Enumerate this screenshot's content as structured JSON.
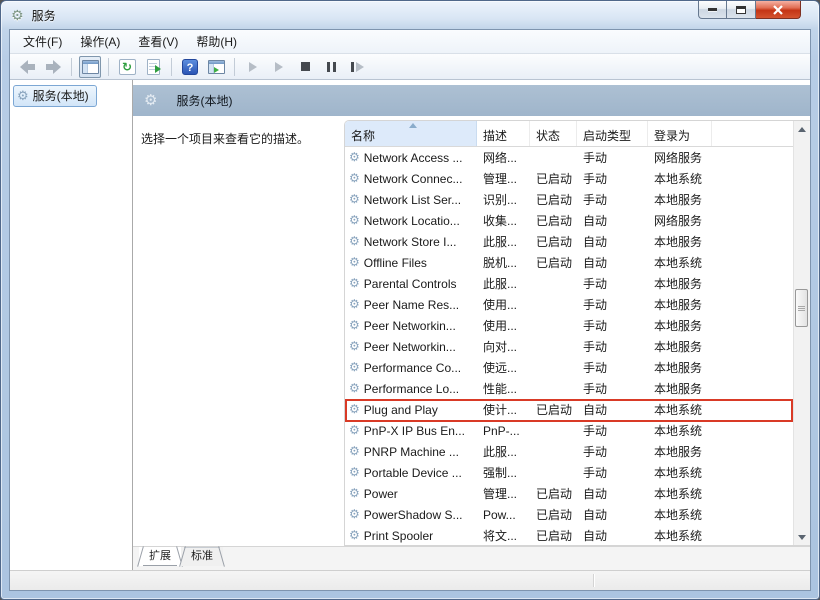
{
  "window": {
    "title": "服务",
    "controls": {
      "minimize": "minimize",
      "maximize": "maximize",
      "close": "close"
    }
  },
  "menu": {
    "items": [
      "文件(F)",
      "操作(A)",
      "查看(V)",
      "帮助(H)"
    ]
  },
  "toolbar": {
    "icons": [
      "back",
      "forward",
      "show-console-tree",
      "refresh",
      "export-list",
      "help",
      "show-action-pane",
      "start-service",
      "resume-service",
      "stop-service",
      "pause-service",
      "restart-service"
    ]
  },
  "tree": {
    "root_label": "服务(本地)"
  },
  "main": {
    "band_title": "服务(本地)",
    "description_hint": "选择一个项目来查看它的描述。",
    "columns": [
      "名称",
      "描述",
      "状态",
      "启动类型",
      "登录为"
    ],
    "sorted_column": "名称",
    "rows": [
      {
        "name": "Network Access ...",
        "desc": "网络...",
        "status": "",
        "startup": "手动",
        "logon": "网络服务"
      },
      {
        "name": "Network Connec...",
        "desc": "管理...",
        "status": "已启动",
        "startup": "手动",
        "logon": "本地系统"
      },
      {
        "name": "Network List Ser...",
        "desc": "识别...",
        "status": "已启动",
        "startup": "手动",
        "logon": "本地服务"
      },
      {
        "name": "Network Locatio...",
        "desc": "收集...",
        "status": "已启动",
        "startup": "自动",
        "logon": "网络服务"
      },
      {
        "name": "Network Store I...",
        "desc": "此服...",
        "status": "已启动",
        "startup": "自动",
        "logon": "本地服务"
      },
      {
        "name": "Offline Files",
        "desc": "脱机...",
        "status": "已启动",
        "startup": "自动",
        "logon": "本地系统"
      },
      {
        "name": "Parental Controls",
        "desc": "此服...",
        "status": "",
        "startup": "手动",
        "logon": "本地服务"
      },
      {
        "name": "Peer Name Res...",
        "desc": "使用...",
        "status": "",
        "startup": "手动",
        "logon": "本地服务"
      },
      {
        "name": "Peer Networkin...",
        "desc": "使用...",
        "status": "",
        "startup": "手动",
        "logon": "本地服务"
      },
      {
        "name": "Peer Networkin...",
        "desc": "向对...",
        "status": "",
        "startup": "手动",
        "logon": "本地服务"
      },
      {
        "name": "Performance Co...",
        "desc": "使远...",
        "status": "",
        "startup": "手动",
        "logon": "本地服务"
      },
      {
        "name": "Performance Lo...",
        "desc": "性能...",
        "status": "",
        "startup": "手动",
        "logon": "本地服务"
      },
      {
        "name": "Plug and Play",
        "desc": "使计...",
        "status": "已启动",
        "startup": "自动",
        "logon": "本地系统",
        "highlighted": true
      },
      {
        "name": "PnP-X IP Bus En...",
        "desc": "PnP-...",
        "status": "",
        "startup": "手动",
        "logon": "本地系统"
      },
      {
        "name": "PNRP Machine ...",
        "desc": "此服...",
        "status": "",
        "startup": "手动",
        "logon": "本地服务"
      },
      {
        "name": "Portable Device ...",
        "desc": "强制...",
        "status": "",
        "startup": "手动",
        "logon": "本地系统"
      },
      {
        "name": "Power",
        "desc": "管理...",
        "status": "已启动",
        "startup": "自动",
        "logon": "本地系统"
      },
      {
        "name": "PowerShadow S...",
        "desc": "Pow...",
        "status": "已启动",
        "startup": "自动",
        "logon": "本地系统"
      },
      {
        "name": "Print Spooler",
        "desc": "将文...",
        "status": "已启动",
        "startup": "自动",
        "logon": "本地系统"
      }
    ],
    "highlighted_row": "Plug and Play",
    "tabs": [
      "扩展",
      "标准"
    ],
    "active_tab": "扩展"
  },
  "colors": {
    "band_background": "#a4b9ce",
    "highlight_border": "#d93a26",
    "sorted_header_background": "#ddeafa",
    "close_button": "#c43415",
    "frame": "#b7cde6"
  }
}
